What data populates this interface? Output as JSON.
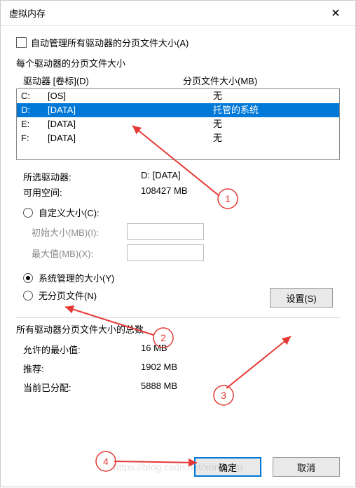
{
  "window": {
    "title": "虚拟内存",
    "close_glyph": "✕"
  },
  "auto_manage": {
    "label": "自动管理所有驱动器的分页文件大小(A)",
    "checked": false
  },
  "per_drive_label": "每个驱动器的分页文件大小",
  "headers": {
    "drive": "驱动器 [卷标](D)",
    "size": "分页文件大小(MB)"
  },
  "drives": [
    {
      "letter": "C:",
      "label": "[OS]",
      "size": "无",
      "selected": false
    },
    {
      "letter": "D:",
      "label": "[DATA]",
      "size": "托管的系统",
      "selected": true
    },
    {
      "letter": "E:",
      "label": "[DATA]",
      "size": "无",
      "selected": false
    },
    {
      "letter": "F:",
      "label": "[DATA]",
      "size": "无",
      "selected": false
    }
  ],
  "selected_info": {
    "drive_label": "所选驱动器:",
    "drive_value": "D:  [DATA]",
    "avail_label": "可用空间:",
    "avail_value": "108427 MB"
  },
  "radios": {
    "custom": "自定义大小(C):",
    "system": "系统管理的大小(Y)",
    "none": "无分页文件(N)",
    "selected": "system"
  },
  "inputs": {
    "initial_label": "初始大小(MB)(I):",
    "max_label": "最大值(MB)(X):"
  },
  "set_button": "设置(S)",
  "totals": {
    "section_label": "所有驱动器分页文件大小的总数",
    "min_label": "允许的最小值:",
    "min_value": "16 MB",
    "rec_label": "推荐:",
    "rec_value": "1902 MB",
    "cur_label": "当前已分配:",
    "cur_value": "5888 MB"
  },
  "buttons": {
    "ok": "确定",
    "cancel": "取消"
  },
  "annotations": {
    "n1": "1",
    "n2": "2",
    "n3": "3",
    "n4": "4"
  },
  "watermark": "https://blog.csdn.net/xrinosvip"
}
